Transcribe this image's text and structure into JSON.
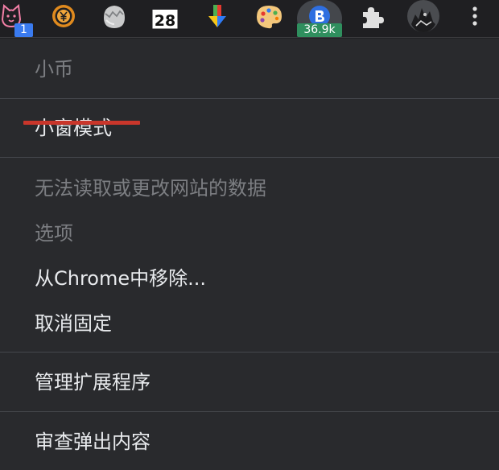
{
  "toolbar": {
    "extensions": [
      {
        "icon": "cat-face-icon",
        "badge": "1"
      },
      {
        "icon": "yuan-coin-icon"
      },
      {
        "icon": "cracked-egg-icon"
      },
      {
        "icon": "calendar-icon",
        "day": "28"
      },
      {
        "icon": "colored-arrow-down-icon"
      },
      {
        "icon": "palette-icon"
      },
      {
        "icon": "b-coin-icon",
        "badge": "36.9k"
      },
      {
        "icon": "puzzle-piece-icon"
      },
      {
        "icon": "profile-avatar-icon"
      },
      {
        "icon": "more-vert-icon"
      }
    ],
    "colors": {
      "badge_blue": "#3a7bf0",
      "badge_green": "#2f8f5e",
      "underline_red": "#c9362b"
    }
  },
  "menu": {
    "header": "小币",
    "popup_mode": "小窗模式",
    "site_access": "无法读取或更改网站的数据",
    "options": "选项",
    "remove": "从Chrome中移除...",
    "unpin": "取消固定",
    "manage": "管理扩展程序",
    "inspect": "审查弹出内容"
  }
}
